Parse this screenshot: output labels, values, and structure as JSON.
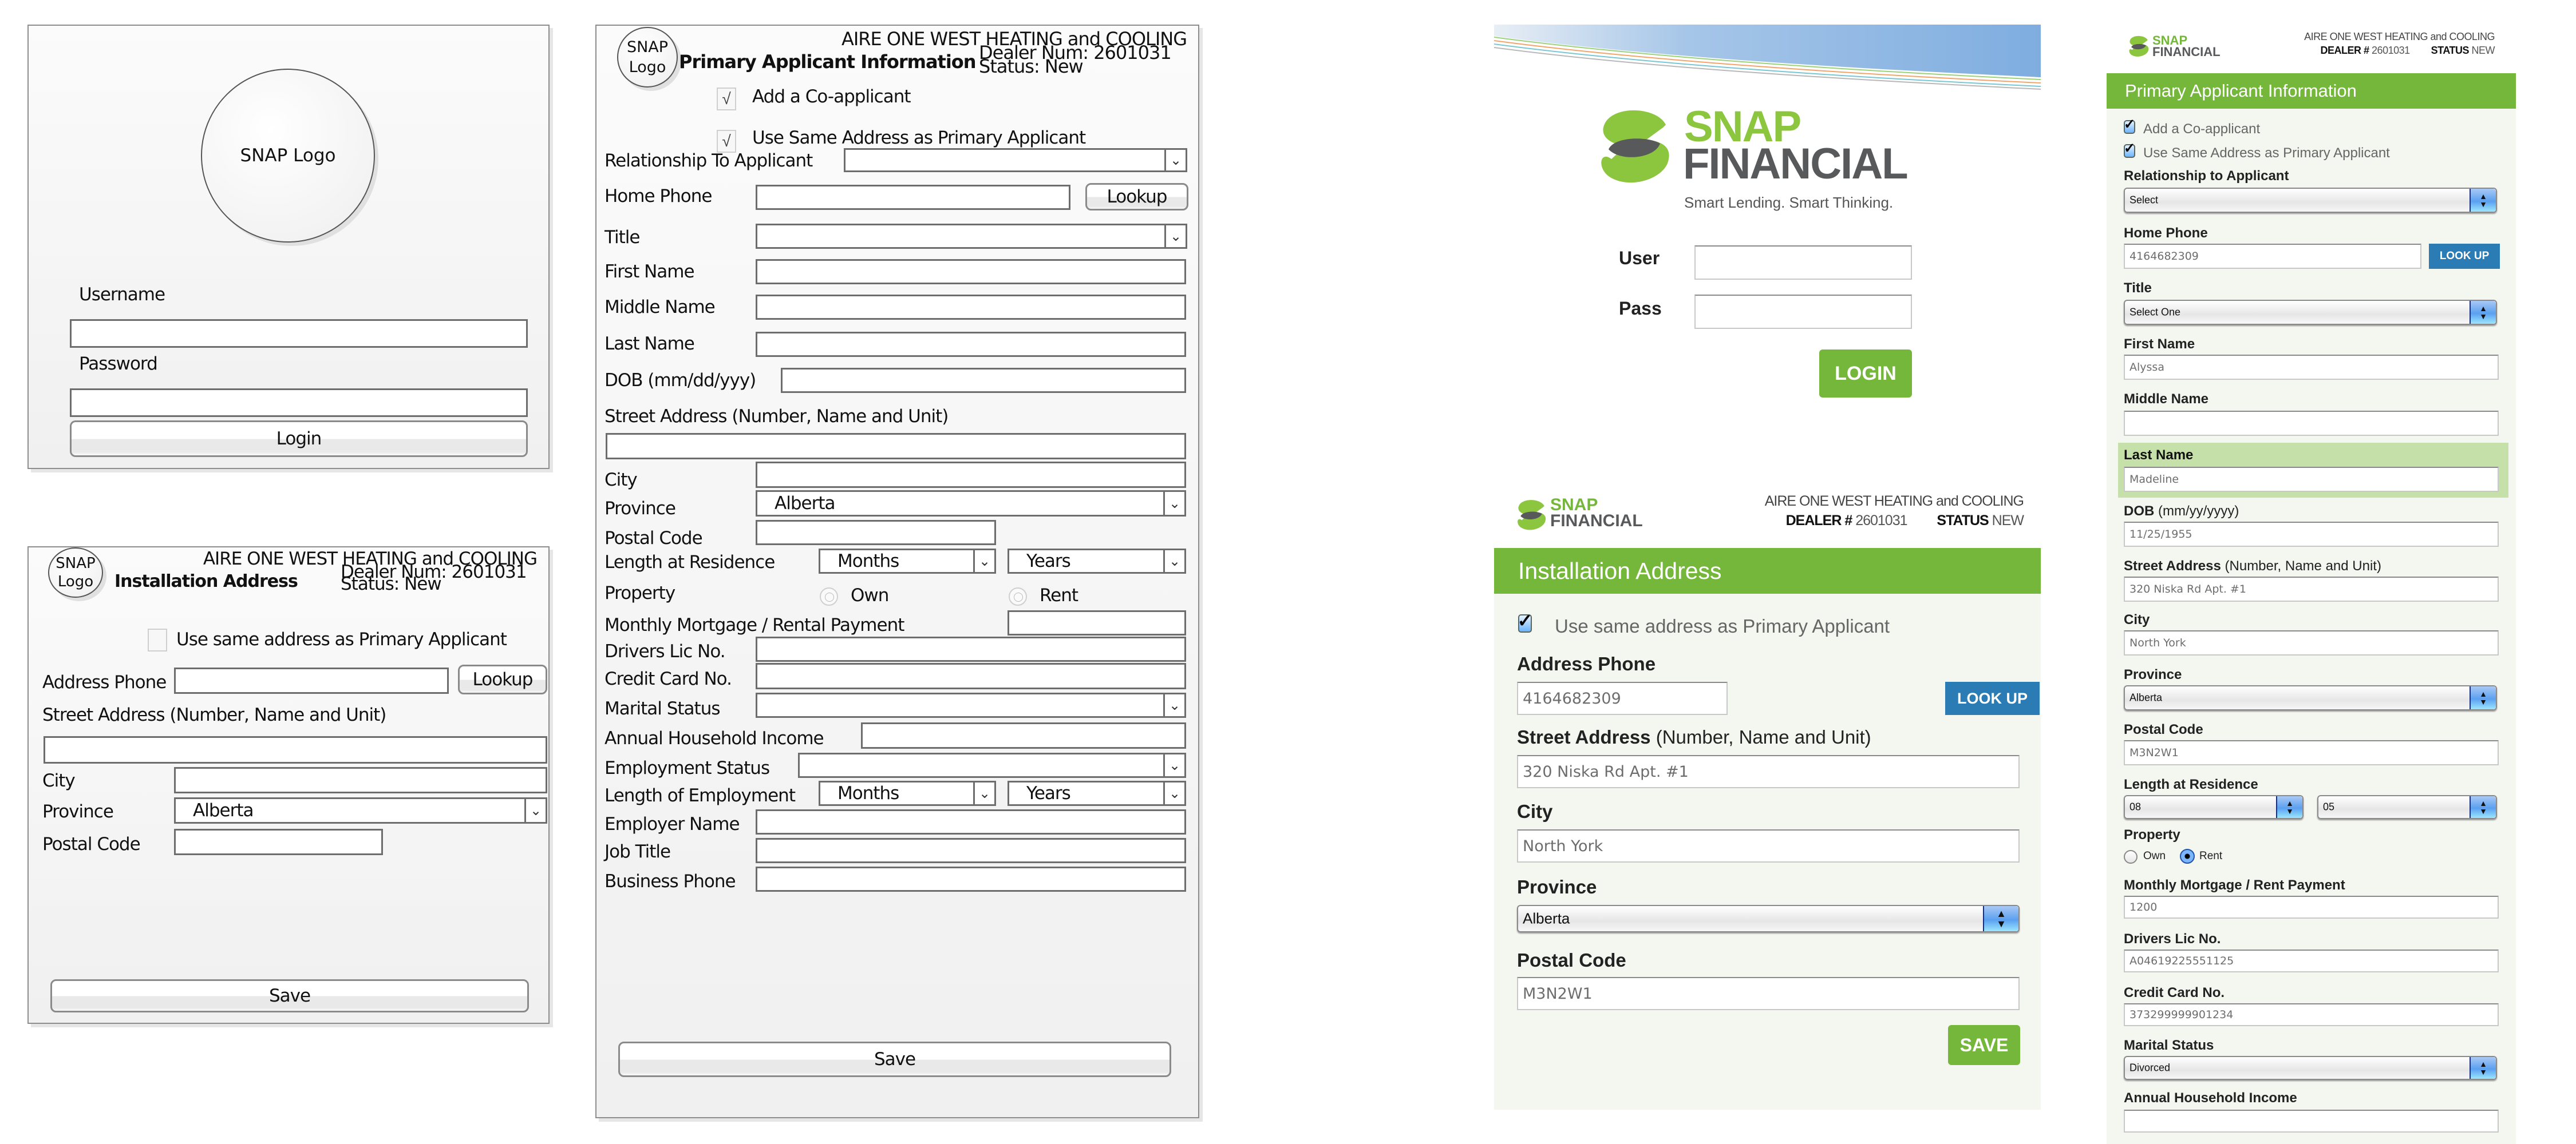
{
  "wireframe_login": {
    "logo_text": "SNAP Logo",
    "username_label": "Username",
    "username_value": "",
    "password_label": "Password",
    "password_value": "",
    "login_button": "Login"
  },
  "wireframe_installation": {
    "logo_line1": "SNAP",
    "logo_line2": "Logo",
    "page_title": "Installation Address",
    "dealer_name": "AIRE ONE WEST HEATING and COOLING",
    "dealer_num": "Dealer Num: 2601031",
    "status": "Status: New",
    "same_address_label": "Use same address as Primary Applicant",
    "same_address_checked": false,
    "address_phone_label": "Address Phone",
    "address_phone_value": "",
    "lookup_button": "Lookup",
    "street_label": "Street Address (Number, Name and Unit)",
    "street_value": "",
    "city_label": "City",
    "city_value": "",
    "province_label": "Province",
    "province_value": "Alberta",
    "postal_label": "Postal Code",
    "postal_value": "",
    "save_button": "Save"
  },
  "wireframe_primary": {
    "logo_line1": "SNAP",
    "logo_line2": "Logo",
    "page_title": "Primary Applicant Information",
    "dealer_name": "AIRE ONE WEST HEATING and COOLING",
    "dealer_num": "Dealer Num: 2601031",
    "status": "Status: New",
    "coapplicant_label": "Add a Co-applicant",
    "coapplicant_checked": true,
    "same_address_label": "Use Same Address as Primary Applicant",
    "same_address_checked": true,
    "check_glyph": "√",
    "select_arrow": "⌄",
    "relationship_label": "Relationship To Applicant",
    "relationship_value": "",
    "home_phone_label": "Home Phone",
    "home_phone_value": "",
    "lookup_button": "Lookup",
    "title_label": "Title",
    "title_value": "",
    "first_name_label": "First Name",
    "middle_name_label": "Middle Name",
    "last_name_label": "Last Name",
    "dob_label": "DOB (mm/dd/yyy)",
    "street_label": "Street Address (Number, Name and Unit)",
    "city_label": "City",
    "province_label": "Province",
    "province_value": "Alberta",
    "postal_label": "Postal Code",
    "residence_label": "Length at Residence",
    "months_value": "Months",
    "years_value": "Years",
    "property_label": "Property",
    "own_label": "Own",
    "rent_label": "Rent",
    "own_selected": false,
    "rent_selected": false,
    "mortgage_label": "Monthly Mortgage / Rental Payment",
    "drivers_label": "Drivers Lic No.",
    "credit_label": "Credit Card No.",
    "marital_label": "Marital Status",
    "marital_value": "",
    "income_label": "Annual Household Income",
    "employment_status_label": "Employment Status",
    "employment_status_value": "",
    "employment_length_label": "Length of Employment",
    "employer_label": "Employer Name",
    "job_title_label": "Job Title",
    "business_phone_label": "Business Phone",
    "save_button": "Save"
  },
  "mockup_login": {
    "brand_top": "SNAP",
    "brand_bottom": "FINANCIAL",
    "tagline": "Smart Lending. Smart Thinking.",
    "user_label": "User",
    "user_value": "",
    "pass_label": "Pass",
    "pass_value": "",
    "login_button": "LOGIN"
  },
  "mockup_installation": {
    "brand_top": "SNAP",
    "brand_bottom": "FINANCIAL",
    "dealer_name": "AIRE ONE WEST HEATING and COOLING",
    "dealer_label": "DEALER #",
    "dealer_num": "2601031",
    "status_label": "STATUS",
    "status_value": "NEW",
    "banner_title": "Installation Address",
    "same_address_label": "Use same address as Primary Applicant",
    "same_address_checked": true,
    "address_phone_label": "Address Phone",
    "address_phone_value": "4164682309",
    "lookup_button": "LOOK UP",
    "street_label_bold": "Street Address",
    "street_label_light": "(Number, Name and Unit)",
    "street_value": "320 Niska Rd Apt. #1",
    "city_label": "City",
    "city_value": "North York",
    "province_label": "Province",
    "province_value": "Alberta",
    "postal_label": "Postal Code",
    "postal_value": "M3N2W1",
    "save_button": "SAVE"
  },
  "mockup_primary": {
    "brand_top": "SNAP",
    "brand_bottom": "FINANCIAL",
    "dealer_name": "AIRE ONE WEST HEATING and COOLING",
    "dealer_label": "DEALER #",
    "dealer_num": "2601031",
    "status_label": "STATUS",
    "status_value": "NEW",
    "banner_title": "Primary Applicant Information",
    "coapplicant_label": "Add a Co-applicant",
    "coapplicant_checked": true,
    "same_address_label": "Use Same Address as Primary Applicant",
    "same_address_checked": true,
    "relationship_label": "Relationship to Applicant",
    "relationship_value": "Select",
    "home_phone_label": "Home Phone",
    "home_phone_value": "4164682309",
    "lookup_button": "LOOK UP",
    "title_label": "Title",
    "title_value": "Select One",
    "first_name_label": "First Name",
    "first_name_value": "Alyssa",
    "middle_name_label": "Middle Name",
    "middle_name_value": "",
    "last_name_label": "Last Name",
    "last_name_value": "Madeline",
    "dob_label_bold": "DOB",
    "dob_label_light": "(mm/yy/yyyy)",
    "dob_value": "11/25/1955",
    "street_label_bold": "Street Address",
    "street_label_light": "(Number, Name and Unit)",
    "street_value": "320 Niska Rd Apt. #1",
    "city_label": "City",
    "city_value": "North York",
    "province_label": "Province",
    "province_value": "Alberta",
    "postal_label": "Postal Code",
    "postal_value": "M3N2W1",
    "residence_label": "Length at Residence",
    "residence_months_value": "08",
    "residence_years_value": "05",
    "property_label": "Property",
    "own_label": "Own",
    "rent_label": "Rent",
    "property_selected": "Rent",
    "mortgage_label": "Monthly Mortgage / Rent Payment",
    "mortgage_value": "1200",
    "drivers_label": "Drivers Lic No.",
    "drivers_value": "A04619225551125",
    "credit_label": "Credit Card No.",
    "credit_value": "373299999901234",
    "marital_label": "Marital Status",
    "marital_value": "Divorced",
    "income_label": "Annual Household Income",
    "income_value": ""
  },
  "colors": {
    "brand_green": "#74b73a",
    "brand_dark": "#555555",
    "lookup_blue": "#2b7bb4",
    "panel_bg": "#f4f6f0",
    "highlight_green": "#c5e0a8"
  }
}
